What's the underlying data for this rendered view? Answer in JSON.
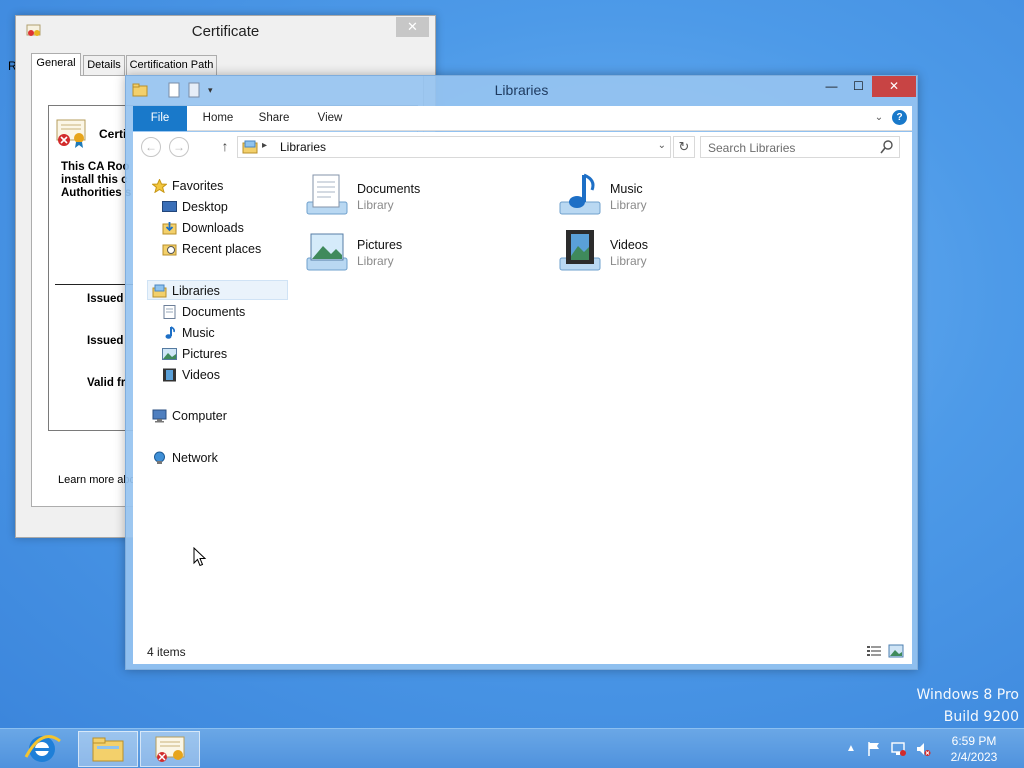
{
  "desktop": {
    "watermark_line1": "Windows 8 Pro",
    "watermark_line2": "Build 9200",
    "edge_char": "R"
  },
  "certificate": {
    "title": "Certificate",
    "tabs": [
      "General",
      "Details",
      "Certification Path"
    ],
    "active_tab": "General",
    "heading": "Certi",
    "body_line1": "This CA Roo",
    "body_line2": "install this c",
    "body_line3": "Authorities s",
    "issued_to": "Issued",
    "issued_by": "Issued",
    "valid_from": "Valid fr",
    "learn_more": "Learn more about"
  },
  "explorer": {
    "title": "Libraries",
    "ribbon_tabs": [
      "File",
      "Home",
      "Share",
      "View"
    ],
    "address": "Libraries",
    "search_placeholder": "Search Libraries",
    "nav": {
      "favorites": "Favorites",
      "desktop": "Desktop",
      "downloads": "Downloads",
      "recent_places": "Recent places",
      "libraries": "Libraries",
      "documents": "Documents",
      "music": "Music",
      "pictures": "Pictures",
      "videos": "Videos",
      "computer": "Computer",
      "network": "Network"
    },
    "items": [
      {
        "name": "Documents",
        "type": "Library",
        "icon": "documents-library-icon"
      },
      {
        "name": "Music",
        "type": "Library",
        "icon": "music-library-icon"
      },
      {
        "name": "Pictures",
        "type": "Library",
        "icon": "pictures-library-icon"
      },
      {
        "name": "Videos",
        "type": "Library",
        "icon": "videos-library-icon"
      }
    ],
    "status": "4 items"
  },
  "taskbar": {
    "pinned": [
      "internet-explorer-icon",
      "file-explorer-icon",
      "certificate-icon"
    ],
    "time": "6:59 PM",
    "date": "2/4/2023"
  },
  "colors": {
    "accent": "#1979ca",
    "desktop": "#4d9ae8",
    "close": "#c84444"
  }
}
